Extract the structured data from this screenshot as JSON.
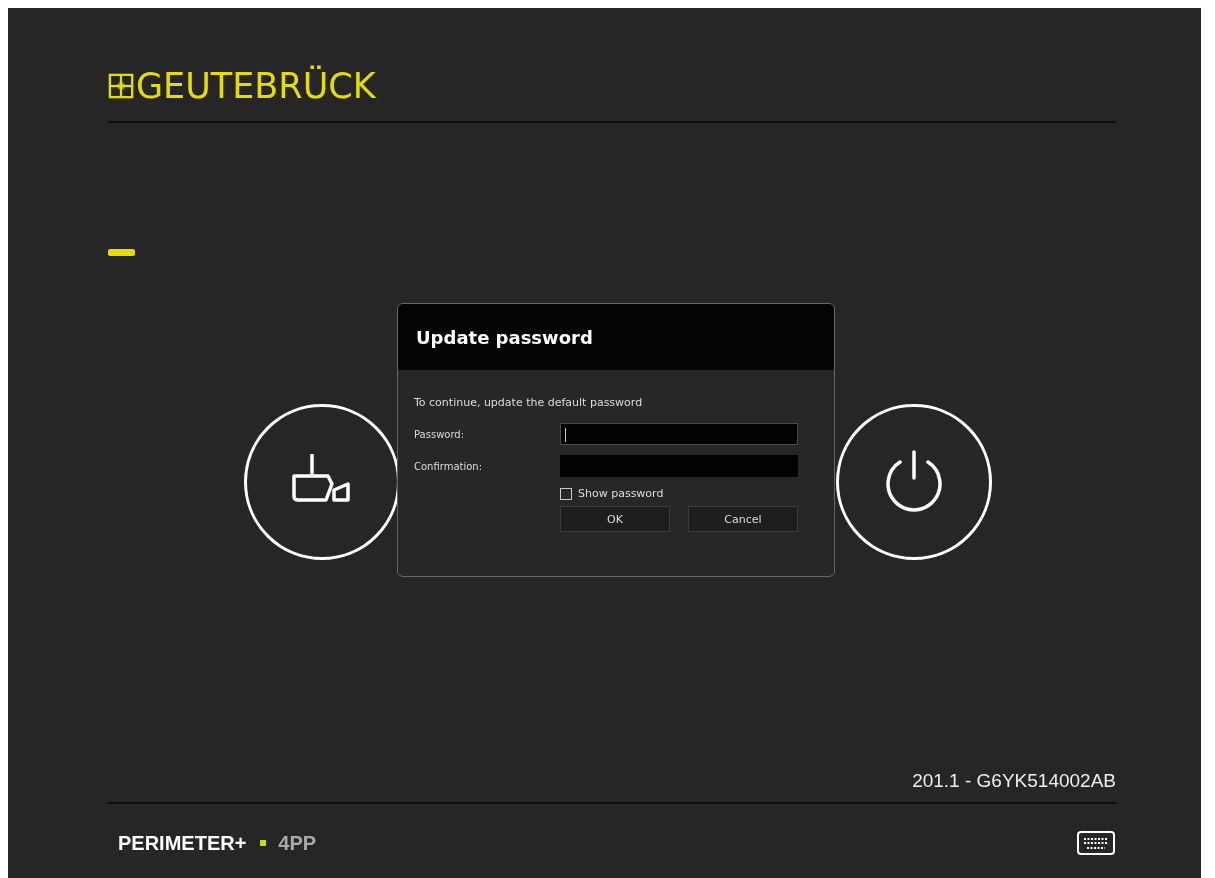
{
  "logo": {
    "text": "GEUTEBRÜCK"
  },
  "actions": [
    {
      "kind": "camera"
    },
    {
      "kind": "power"
    }
  ],
  "dialog": {
    "title": "Update password",
    "message": "To continue, update the default password",
    "fields": [
      {
        "label": "Password:",
        "focused": true
      },
      {
        "label": "Confirmation:",
        "focused": false
      }
    ],
    "show_password": {
      "label": "Show password",
      "checked": false
    },
    "buttons": [
      "OK",
      "Cancel"
    ]
  },
  "version": "201.1 - G6YK514002AB",
  "footer": {
    "product": "PERIMETER+",
    "model": "4PP"
  }
}
